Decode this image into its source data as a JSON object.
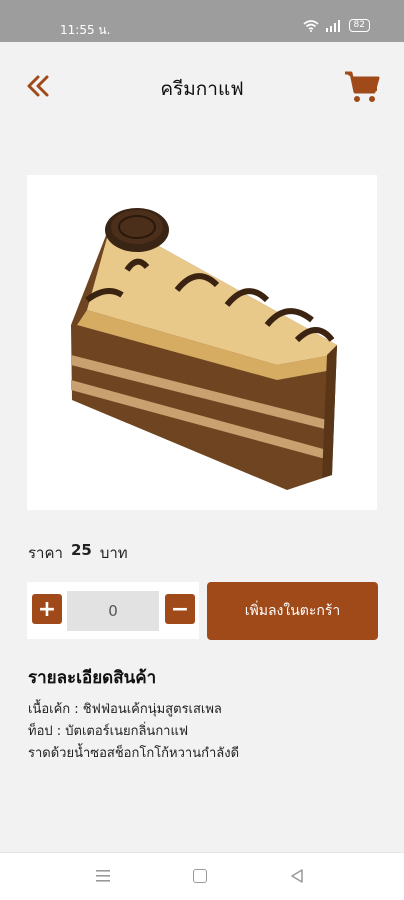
{
  "status_bar": {
    "time": "11:55 น.",
    "battery": "82"
  },
  "header": {
    "title": "ครีมกาแฟ"
  },
  "price": {
    "label": "ราคา",
    "value": "25",
    "unit": "บาท"
  },
  "quantity": {
    "value": "0",
    "plus_symbol": "+",
    "minus_symbol": "−"
  },
  "add_to_cart_label": "เพิ่มลงในตะกร้า",
  "details": {
    "heading": "รายละเอียดสินค้า",
    "lines": [
      "เนื้อเค้ก : ชิฟฟ่อนเค้กนุ่มสูตรเสเพล",
      "ท็อป : บัตเตอร์เนยกลิ่นกาแฟ",
      "ราดด้วยน้ำซอสช็อกโกโก้หวานกำลังดี"
    ]
  },
  "colors": {
    "accent": "#a04a19",
    "background": "#f2f2f2",
    "status_bar": "#9d9d9d"
  },
  "icons": [
    "back-double-chevron-icon",
    "cart-icon",
    "cake-image",
    "nav-menu-icon",
    "nav-home-icon",
    "nav-back-icon"
  ]
}
